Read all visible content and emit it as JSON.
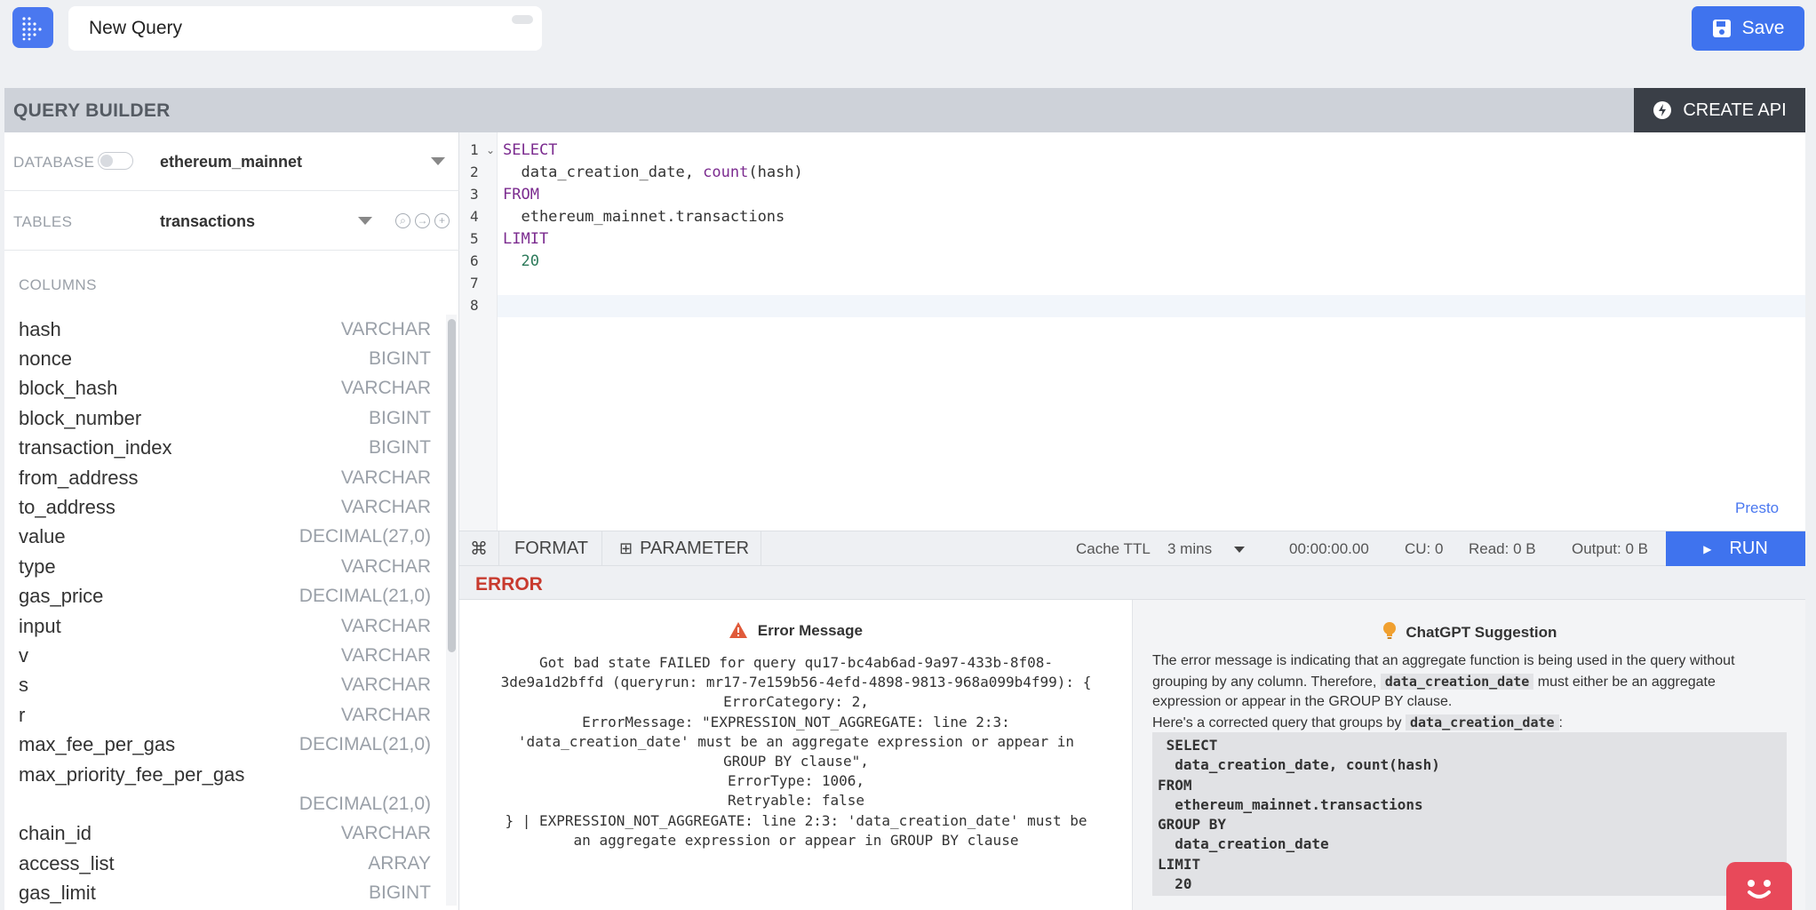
{
  "header": {
    "query_title": "New Query",
    "save_label": "Save"
  },
  "builder": {
    "title": "QUERY BUILDER",
    "create_api_label": "CREATE API"
  },
  "sidebar": {
    "database_label": "DATABASE",
    "database_value": "ethereum_mainnet",
    "tables_label": "TABLES",
    "tables_value": "transactions",
    "columns_label": "COLUMNS",
    "columns": [
      {
        "name": "hash",
        "type": "VARCHAR"
      },
      {
        "name": "nonce",
        "type": "BIGINT"
      },
      {
        "name": "block_hash",
        "type": "VARCHAR"
      },
      {
        "name": "block_number",
        "type": "BIGINT"
      },
      {
        "name": "transaction_index",
        "type": "BIGINT"
      },
      {
        "name": "from_address",
        "type": "VARCHAR"
      },
      {
        "name": "to_address",
        "type": "VARCHAR"
      },
      {
        "name": "value",
        "type": "DECIMAL(27,0)"
      },
      {
        "name": "type",
        "type": "VARCHAR"
      },
      {
        "name": "gas_price",
        "type": "DECIMAL(21,0)"
      },
      {
        "name": "input",
        "type": "VARCHAR"
      },
      {
        "name": "v",
        "type": "VARCHAR"
      },
      {
        "name": "s",
        "type": "VARCHAR"
      },
      {
        "name": "r",
        "type": "VARCHAR"
      },
      {
        "name": "max_fee_per_gas",
        "type": "DECIMAL(21,0)"
      },
      {
        "name": "max_priority_fee_per_gas",
        "type": "DECIMAL(21,0)"
      },
      {
        "name": "chain_id",
        "type": "VARCHAR"
      },
      {
        "name": "access_list",
        "type": "ARRAY"
      },
      {
        "name": "gas_limit",
        "type": "BIGINT"
      }
    ]
  },
  "editor": {
    "line_numbers": [
      "1",
      "2",
      "3",
      "4",
      "5",
      "6",
      "7",
      "8"
    ],
    "lines": [
      {
        "kw": "SELECT"
      },
      {
        "text": "  data_creation_date, ",
        "fn": "count",
        "rest": "(hash)"
      },
      {
        "kw": "FROM"
      },
      {
        "text": "  ethereum_mainnet.transactions"
      },
      {
        "kw": "LIMIT"
      },
      {
        "num": "  20"
      },
      {
        "text": ""
      },
      {
        "text": ""
      }
    ],
    "engine_label": "Presto"
  },
  "toolbar": {
    "format_label": "FORMAT",
    "parameter_label": "PARAMETER",
    "cache_ttl_label": "Cache TTL",
    "cache_ttl_value": "3 mins",
    "elapsed": "00:00:00.00",
    "cu": "CU: 0",
    "read": "Read: 0 B",
    "output": "Output: 0 B",
    "run_label": "RUN"
  },
  "error": {
    "header": "ERROR",
    "title": "Error Message",
    "message": "Got bad state FAILED for query qu17-bc4ab6ad-9a97-433b-8f08-\n3de9a1d2bffd (queryrun: mr17-7e159b56-4efd-4898-9813-968a099b4f99): {\nErrorCategory: 2,\nErrorMessage: \"EXPRESSION_NOT_AGGREGATE: line 2:3:\n'data_creation_date' must be an aggregate expression or appear in\nGROUP BY clause\",\nErrorType: 1006,\nRetryable: false\n} | EXPRESSION_NOT_AGGREGATE: line 2:3: 'data_creation_date' must be\nan aggregate expression or appear in GROUP BY clause"
  },
  "gpt": {
    "title": "ChatGPT Suggestion",
    "p1_a": "The error message is indicating that an aggregate function is being used in the query without grouping by any column. Therefore, ",
    "p1_code": "data_creation_date",
    "p1_b": " must either be an aggregate expression or appear in the GROUP BY clause.",
    "p2_a": "Here's a corrected query that groups by ",
    "p2_code": "data_creation_date",
    "p2_b": ":",
    "code": " SELECT\n  data_creation_date, count(hash)\nFROM\n  ethereum_mainnet.transactions\nGROUP BY\n  data_creation_date\nLIMIT\n  20"
  },
  "colors": {
    "accent": "#3f73ee",
    "error": "#c83a2e",
    "keyword": "#7b2b8f",
    "number": "#2c7a5a"
  }
}
